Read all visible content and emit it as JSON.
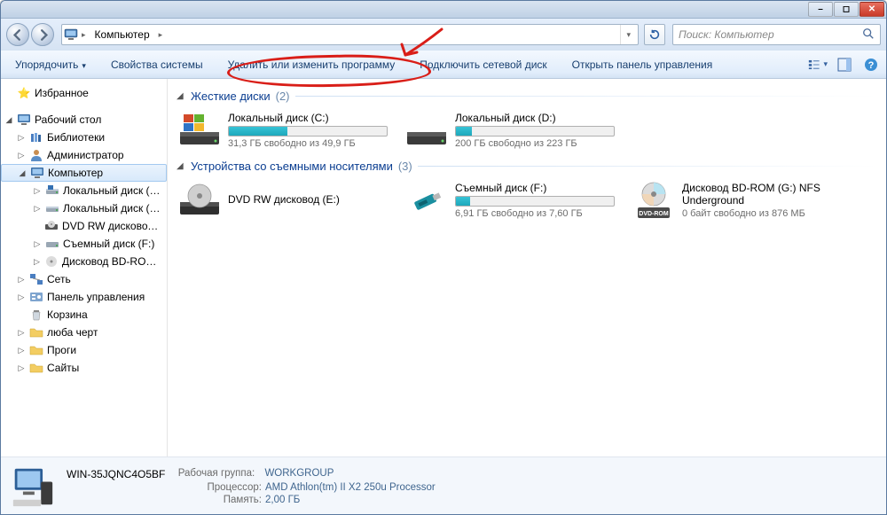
{
  "address": {
    "crumb": "Компьютер"
  },
  "search": {
    "placeholder": "Поиск: Компьютер"
  },
  "toolbar": {
    "organize": "Упорядочить",
    "system_props": "Свойства системы",
    "uninstall": "Удалить или изменить программу",
    "map_drive": "Подключить сетевой диск",
    "control_panel": "Открыть панель управления"
  },
  "tree": {
    "favorites": "Избранное",
    "desktop": "Рабочий стол",
    "libraries": "Библиотеки",
    "admin": "Администратор",
    "computer": "Компьютер",
    "local_c": "Локальный диск (C:)",
    "local_d": "Локальный диск (D:)",
    "dvd_rw": "DVD RW дисковод (E:)",
    "removable_f": "Съемный диск (F:)",
    "bdrom_g": "Дисковод BD-ROM (G:)",
    "network": "Сеть",
    "control_panel": "Панель управления",
    "recycle": "Корзина",
    "lyuba": "люба черт",
    "progi": "Проги",
    "sites": "Сайты"
  },
  "groups": {
    "hdd": {
      "title": "Жесткие диски",
      "count": "(2)"
    },
    "removable": {
      "title": "Устройства со съемными носителями",
      "count": "(3)"
    }
  },
  "drives": {
    "c": {
      "name": "Локальный диск (C:)",
      "sub": "31,3 ГБ свободно из 49,9 ГБ",
      "fill": 37
    },
    "d": {
      "name": "Локальный диск (D:)",
      "sub": "200 ГБ свободно из 223 ГБ",
      "fill": 10
    },
    "dvd": {
      "name": "DVD RW дисковод (E:)"
    },
    "f": {
      "name": "Съемный диск (F:)",
      "sub": "6,91 ГБ свободно из 7,60 ГБ",
      "fill": 9
    },
    "g": {
      "name": "Дисковод BD-ROM (G:) NFS Underground",
      "sub": "0 байт свободно из 876 МБ"
    }
  },
  "details": {
    "name": "WIN-35JQNC4O5BF",
    "workgroup_label": "Рабочая группа:",
    "workgroup": "WORKGROUP",
    "cpu_label": "Процессор:",
    "cpu": "AMD Athlon(tm) II X2 250u Processor",
    "mem_label": "Память:",
    "mem": "2,00 ГБ"
  }
}
